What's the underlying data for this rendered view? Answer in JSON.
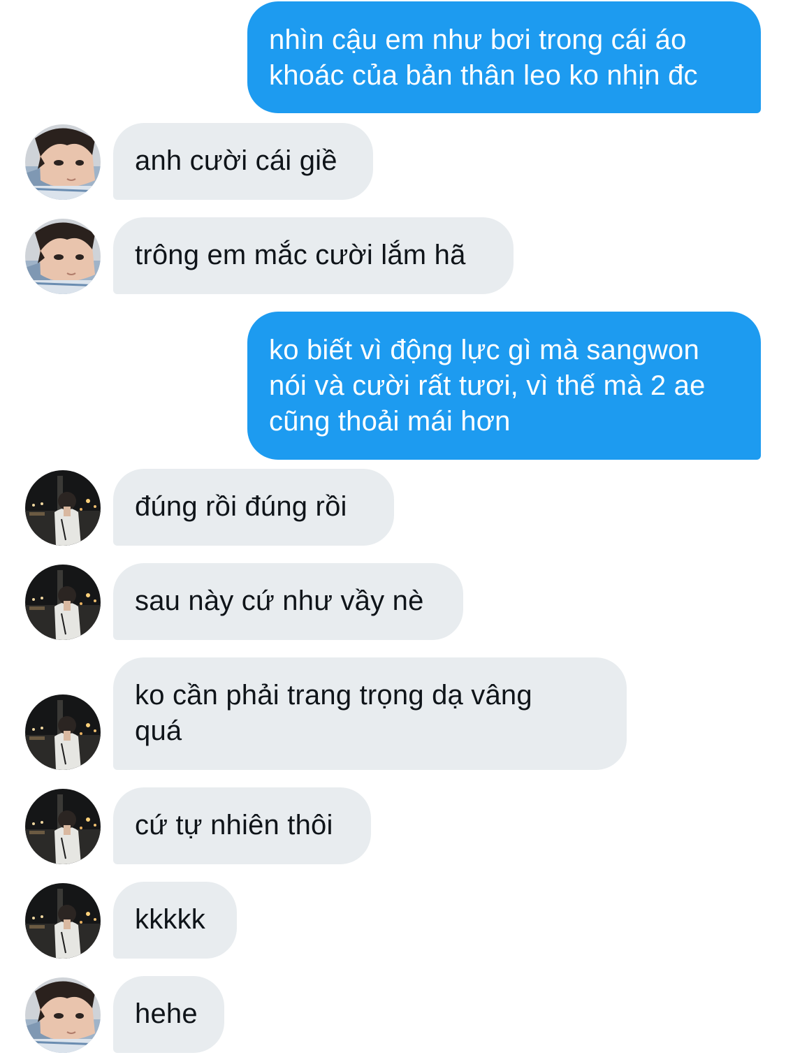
{
  "conversation": {
    "messages": [
      {
        "side": "sent",
        "lines": [
          "nhìn cậu em như bơi trong cái áo",
          "khoác của bản thân leo ko nhịn đc"
        ]
      },
      {
        "side": "received",
        "avatar": "avatar-selfie-icon",
        "lines": [
          "anh cười cái giề"
        ]
      },
      {
        "side": "received",
        "avatar": "avatar-selfie-icon",
        "lines": [
          "trông em mắc cười lắm hã"
        ]
      },
      {
        "side": "sent",
        "lines": [
          "ko biết vì động lực gì mà sangwon",
          "nói và cười rất tươi, vì thế mà 2 ae",
          "cũng thoải mái hơn"
        ]
      },
      {
        "side": "received",
        "avatar": "avatar-night-street-icon",
        "lines": [
          "đúng rồi đúng rồi"
        ]
      },
      {
        "side": "received",
        "avatar": "avatar-night-street-icon",
        "lines": [
          "sau này cứ như vầy nè"
        ]
      },
      {
        "side": "received",
        "avatar": "avatar-night-street-icon",
        "lines": [
          "ko cần phải trang trọng dạ vâng",
          "quá"
        ]
      },
      {
        "side": "received",
        "avatar": "avatar-night-street-icon",
        "lines": [
          "cứ tự nhiên thôi"
        ]
      },
      {
        "side": "received",
        "avatar": "avatar-night-street-icon",
        "lines": [
          "kkkkk"
        ]
      },
      {
        "side": "received",
        "avatar": "avatar-selfie-icon",
        "lines": [
          "hehe"
        ]
      }
    ]
  },
  "colors": {
    "sent_bubble": "#1d9bf0",
    "sent_text": "#ffffff",
    "received_bubble": "#e8ecef",
    "received_text": "#0f1419",
    "background": "#ffffff"
  }
}
